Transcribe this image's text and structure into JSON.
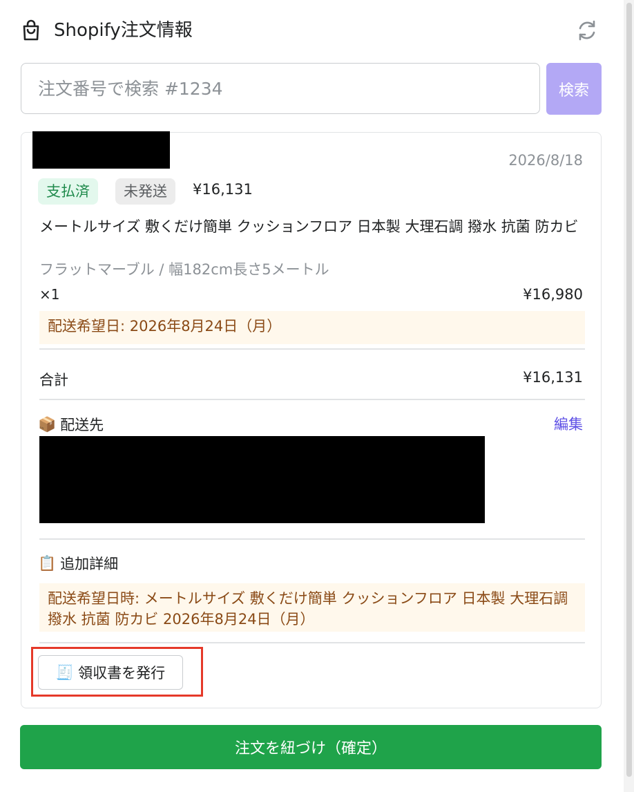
{
  "header": {
    "title": "Shopify注文情報",
    "icon": "shopping-bag-icon",
    "refresh_icon": "refresh-icon"
  },
  "search": {
    "placeholder": "注文番号で検索 #1234",
    "button_label": "検索",
    "button_color": "#b3a8f5"
  },
  "order": {
    "date": "2026/8/18",
    "badges": {
      "paid": "支払済",
      "fulfillment": "未発送"
    },
    "total_inline": "¥16,131",
    "line_item": {
      "title": "メートルサイズ 敷くだけ簡単 クッションフロア 日本製 大理石調 撥水 抗菌 防カビ",
      "variant": "フラットマーブル / 幅182cm長さ5メートル",
      "quantity": "×1",
      "price": "¥16,980"
    },
    "delivery_note": "配送希望日: 2026年8月24日（月）",
    "total": {
      "label": "合計",
      "value": "¥16,131"
    },
    "shipping": {
      "icon": "📦",
      "heading": "配送先",
      "edit_label": "編集"
    },
    "details": {
      "icon": "📋",
      "heading": "追加詳細",
      "note": "配送希望日時: メートルサイズ 敷くだけ簡単 クッションフロア 日本製 大理石調 撥水 抗菌 防カビ 2026年8月24日（月）"
    },
    "receipt_button": {
      "icon": "🧾",
      "label": "領収書を発行"
    }
  },
  "confirm_button": {
    "label": "注文を紐づけ（確定）",
    "color": "#1fa34a"
  },
  "colors": {
    "accent": "#5c4ee5",
    "note_bg": "#fff8ec",
    "note_text": "#8a4a16",
    "highlight": "#e53929"
  }
}
